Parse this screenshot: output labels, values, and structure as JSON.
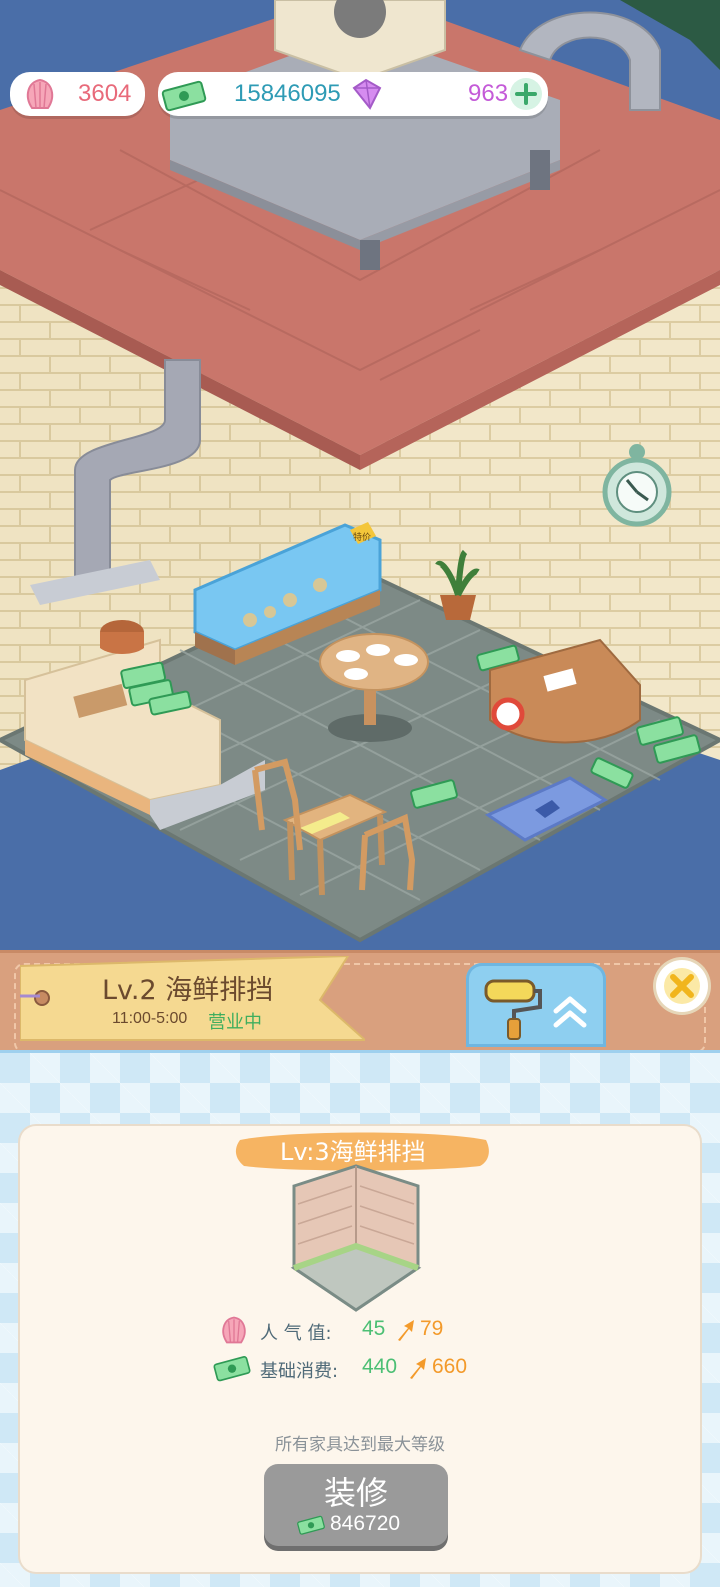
{
  "hud": {
    "shells": "3604",
    "cash": "15846095",
    "gems": "963",
    "add_icon": "plus-icon"
  },
  "scene": {
    "sign_text": "特价"
  },
  "shop": {
    "level_title": "Lv.2 海鲜排挡",
    "hours": "11:00-5:00",
    "status": "营业中"
  },
  "upgrade": {
    "next_title": "Lv:3海鲜排挡",
    "popularity_label": "人 气 值:",
    "popularity_now": "45",
    "popularity_next": "79",
    "base_spend_label": "基础消费:",
    "base_spend_now": "440",
    "base_spend_next": "660",
    "note": "所有家具达到最大等级",
    "button_label": "装修",
    "button_cost": "846720"
  },
  "colors": {
    "cash_text": "#2e9bb5",
    "shell_text": "#e86a7a",
    "gem_text": "#c45ad8",
    "green_value": "#4cbf74",
    "orange_value": "#f39a2a",
    "button_gray": "#9a9a9a"
  }
}
